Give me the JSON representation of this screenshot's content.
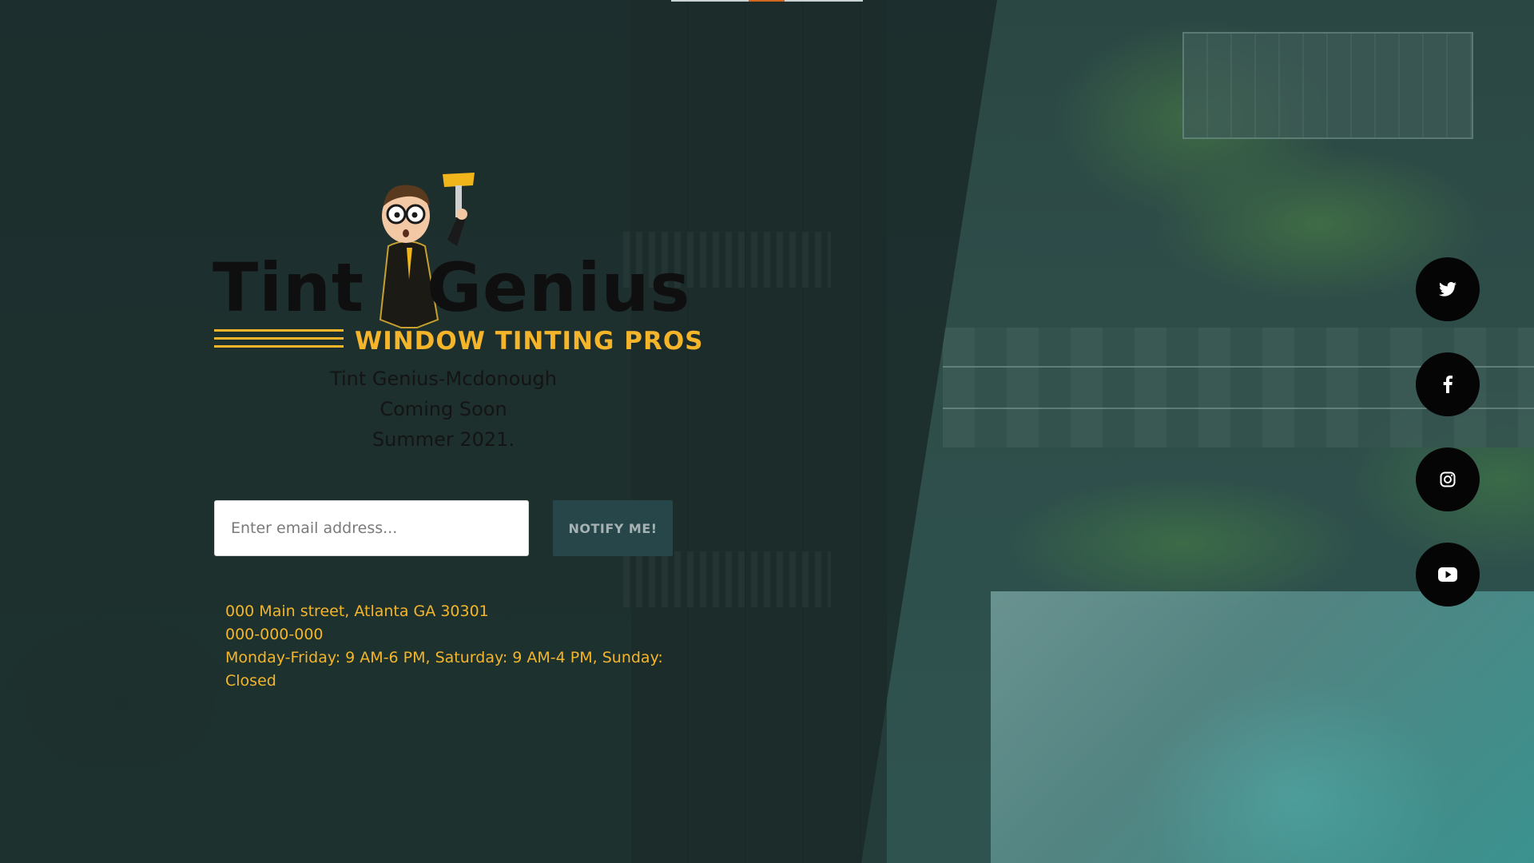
{
  "logo": {
    "word_left": "Tint",
    "word_right": "Genius",
    "tagline": "WINDOW TINTING PROS",
    "brand_dark": "#0f0f0f",
    "brand_accent": "#f4b52a"
  },
  "headline": {
    "line1": "Tint Genius-Mcdonough",
    "line2": "Coming Soon",
    "line3": "Summer 2021."
  },
  "signup": {
    "email_placeholder": "Enter email address...",
    "button_label": "NOTIFY ME!"
  },
  "contact": {
    "address": "000 Main street, Atlanta GA 30301",
    "phone": "000-000-000",
    "hours": "Monday-Friday: 9 AM-6 PM, Saturday: 9 AM-4 PM, Sunday: Closed",
    "text_color": "#f4b52a"
  },
  "social": [
    {
      "name": "twitter",
      "icon": "twitter-icon"
    },
    {
      "name": "facebook",
      "icon": "facebook-icon"
    },
    {
      "name": "instagram",
      "icon": "instagram-icon"
    },
    {
      "name": "youtube",
      "icon": "youtube-icon"
    }
  ],
  "colors": {
    "overlay": "#182826",
    "button_bg": "#26464a",
    "top_indicator": "#d0661f"
  }
}
